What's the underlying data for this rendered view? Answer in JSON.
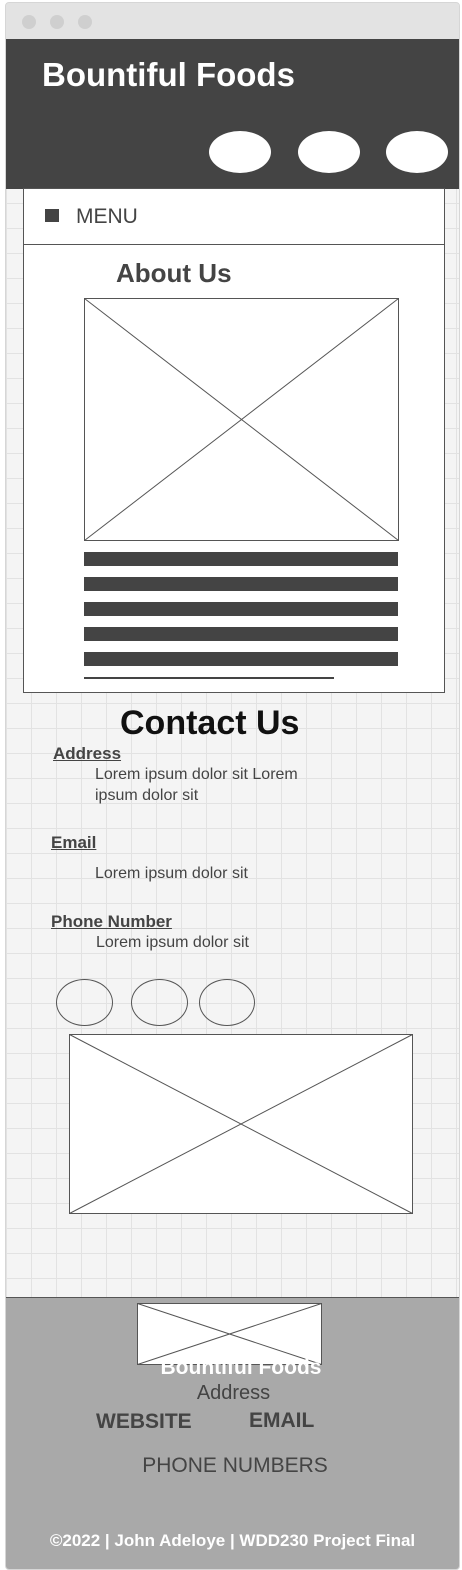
{
  "header": {
    "brand": "Bountiful Foods"
  },
  "nav": {
    "menu_label": "MENU"
  },
  "about": {
    "title": "About Us"
  },
  "contact": {
    "title": "Contact Us",
    "address_label": "Address",
    "address_text_line1": "Lorem ipsum dolor sit Lorem",
    "address_text_line2": "ipsum dolor sit",
    "email_label": "Email",
    "email_text": "Lorem ipsum dolor sit",
    "phone_label": "Phone Number",
    "phone_text": "Lorem ipsum dolor sit"
  },
  "footer": {
    "brand": "Bountiful Foods",
    "address": "Address",
    "website": "WEBSITE",
    "email": "EMAIL",
    "phone": "PHONE NUMBERS",
    "copyright": "©2022 | John Adeloye | WDD230 Project Final"
  },
  "colors": {
    "header_bg": "#444444",
    "footer_bg": "#a9a9a9",
    "canvas_bg": "#f4f4f4",
    "text_dark": "#444444"
  }
}
